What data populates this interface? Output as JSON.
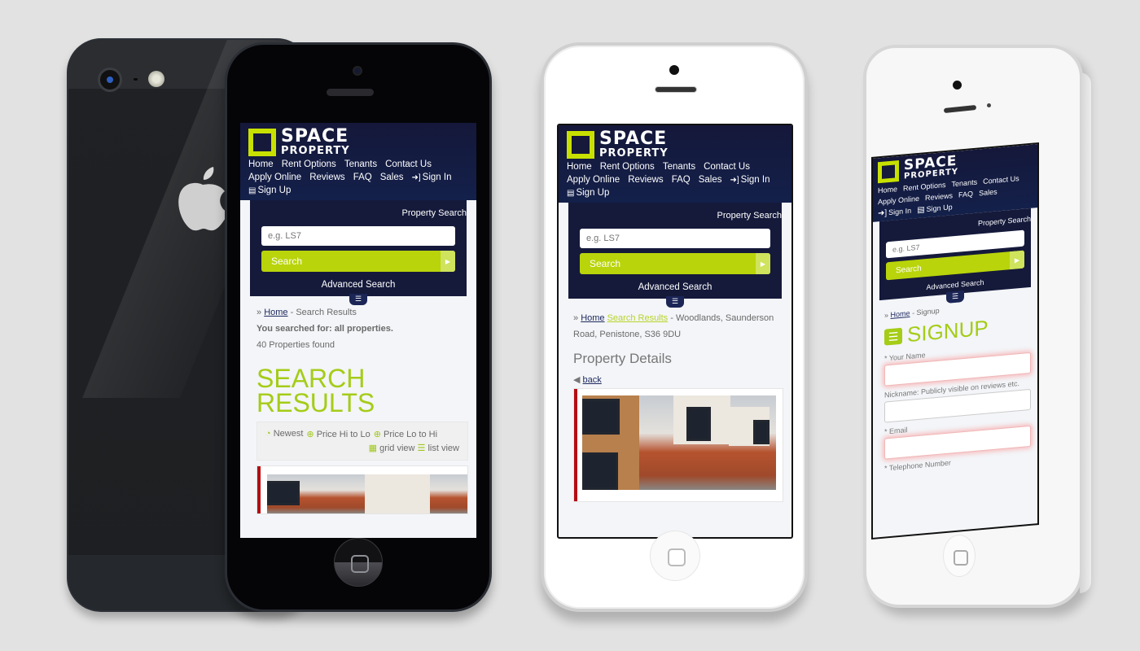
{
  "site": {
    "logo_line1": "SPACE",
    "logo_line2": "PROPERTY",
    "brand_green": "#b9d40a",
    "brand_navy": "#151a3b",
    "nav": [
      {
        "label": "Home"
      },
      {
        "label": "Rent Options"
      },
      {
        "label": "Tenants"
      },
      {
        "label": "Contact Us"
      },
      {
        "label": "Apply Online"
      },
      {
        "label": "Reviews"
      },
      {
        "label": "FAQ"
      },
      {
        "label": "Sales"
      },
      {
        "label": "Sign In",
        "icon": "sign-in-icon"
      },
      {
        "label": "Sign Up",
        "icon": "id-card-icon"
      }
    ],
    "search": {
      "title": "Property Search",
      "placeholder": "e.g. LS7",
      "button_label": "Search",
      "advanced_label": "Advanced Search"
    }
  },
  "phone1": {
    "breadcrumb_sep": "»",
    "breadcrumb_home": "Home",
    "breadcrumb_current": "- Search Results",
    "searched_for": "You searched for: all properties.",
    "count": "40 Properties found",
    "heading_line1": "SEARCH",
    "heading_line2": "RESULTS",
    "sort": [
      {
        "label": "Newest",
        "icon": "clock-icon"
      },
      {
        "label": "Price Hi to Lo",
        "icon": "arrow-up-circle-icon"
      },
      {
        "label": "Price Lo to Hi",
        "icon": "arrow-down-circle-icon"
      }
    ],
    "views": [
      {
        "label": "grid view",
        "icon": "grid-icon"
      },
      {
        "label": "list view",
        "icon": "list-icon"
      }
    ]
  },
  "phone2": {
    "breadcrumb_sep": "»",
    "breadcrumb_home": "Home",
    "breadcrumb_results": "Search Results",
    "breadcrumb_current": "- Woodlands, Saunderson Road, Penistone, S36 9DU",
    "heading": "Property Details",
    "back_label": "back"
  },
  "phone3": {
    "breadcrumb_sep": "»",
    "breadcrumb_home": "Home",
    "breadcrumb_current": "- Signup",
    "heading": "SIGNUP",
    "fields": [
      {
        "label": "* Your Name",
        "required": true
      },
      {
        "label": "Nickname: Publicly visible on reviews etc.",
        "required": false
      },
      {
        "label": "* Email",
        "required": true
      },
      {
        "label": "* Telephone Number",
        "required": true
      }
    ]
  }
}
